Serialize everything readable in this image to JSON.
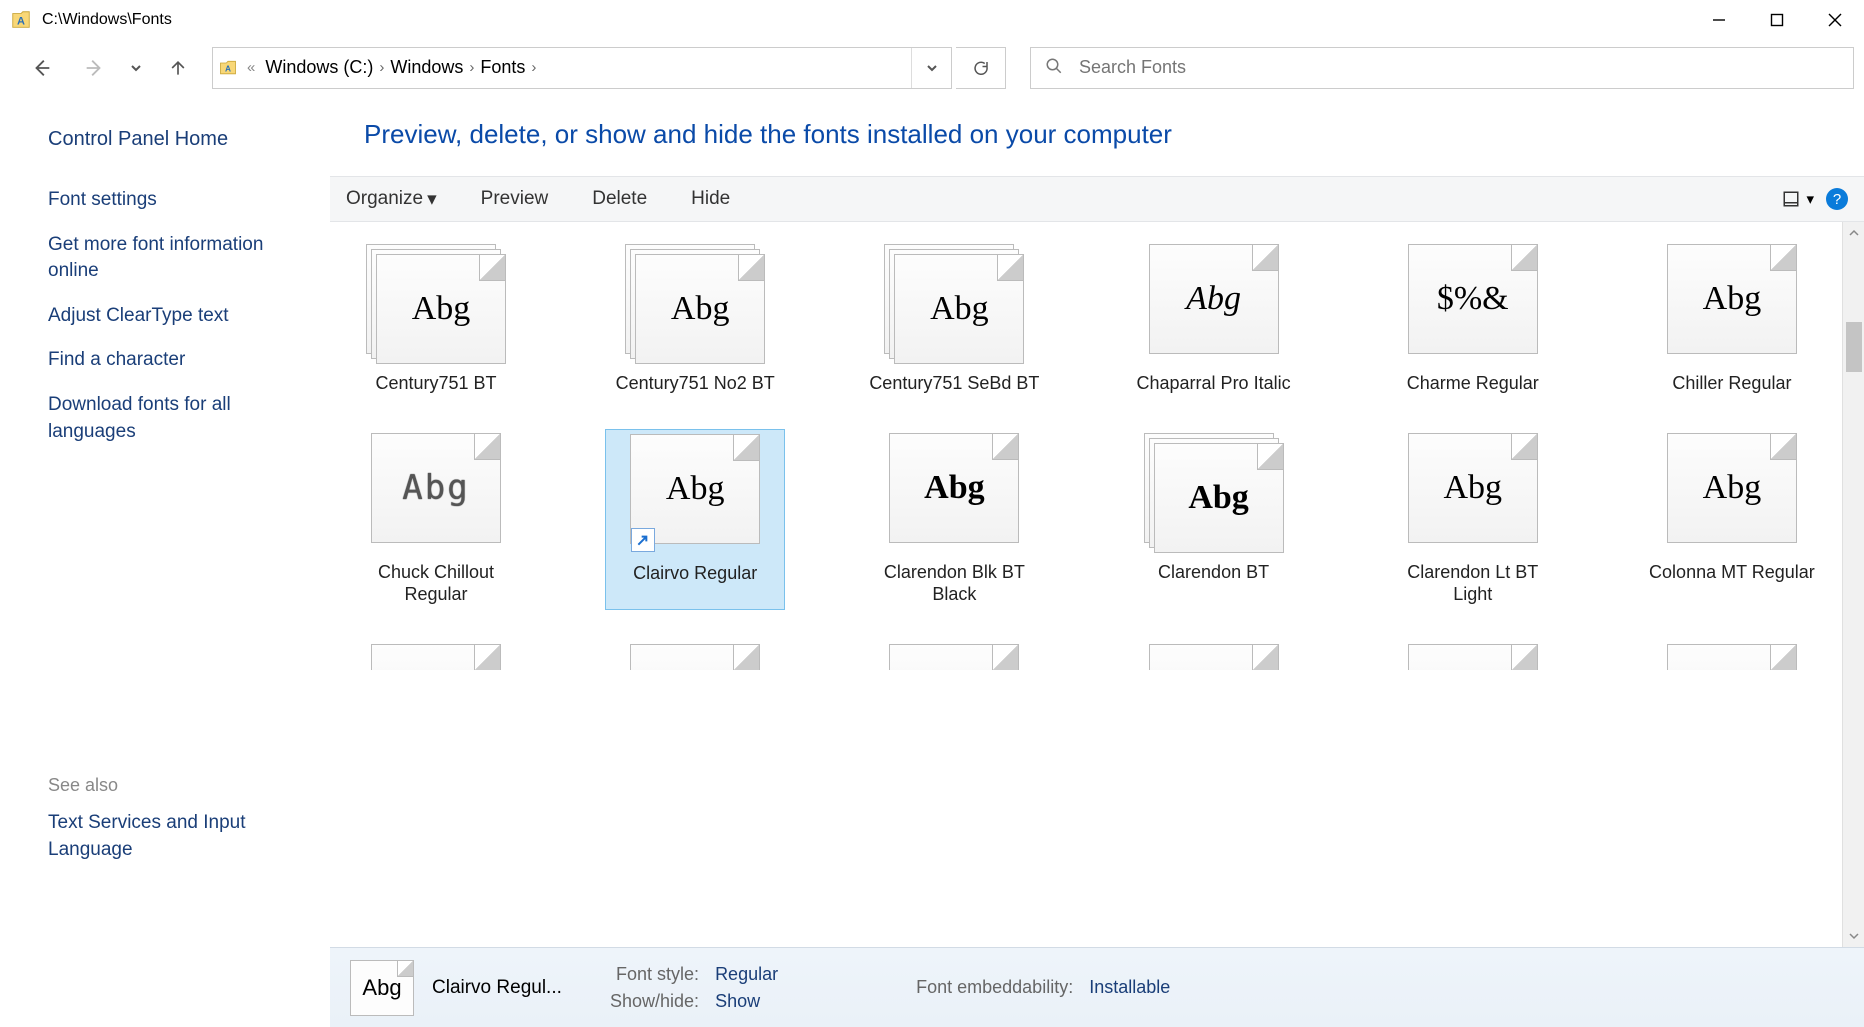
{
  "window": {
    "title": "C:\\Windows\\Fonts"
  },
  "breadcrumbs": {
    "items": [
      {
        "label": "Windows (C:)"
      },
      {
        "label": "Windows"
      },
      {
        "label": "Fonts"
      }
    ]
  },
  "search": {
    "placeholder": "Search Fonts"
  },
  "sidebar": {
    "home": "Control Panel Home",
    "links": [
      "Font settings",
      "Get more font information online",
      "Adjust ClearType text",
      "Find a character",
      "Download fonts for all languages"
    ],
    "see_also_label": "See also",
    "see_also": [
      "Text Services and Input Language"
    ]
  },
  "heading": "Preview, delete, or show and hide the fonts installed on your computer",
  "toolbar": {
    "organize": "Organize",
    "preview": "Preview",
    "delete": "Delete",
    "hide": "Hide",
    "help": "?"
  },
  "fonts": [
    {
      "label": "Century751 BT",
      "sample": "Abg",
      "family": true
    },
    {
      "label": "Century751 No2 BT",
      "sample": "Abg",
      "family": true
    },
    {
      "label": "Century751 SeBd BT",
      "sample": "Abg",
      "family": true
    },
    {
      "label": "Chaparral Pro Italic",
      "sample": "Abg",
      "family": false,
      "italic": true
    },
    {
      "label": "Charme Regular",
      "sample": "$%&",
      "family": false
    },
    {
      "label": "Chiller Regular",
      "sample": "Abg",
      "family": false
    },
    {
      "label": "Chuck Chillout Regular",
      "sample": "Abg",
      "family": false,
      "dotted": true
    },
    {
      "label": "Clairvo Regular",
      "sample": "Abg",
      "family": false,
      "selected": true,
      "shortcut": true
    },
    {
      "label": "Clarendon Blk BT Black",
      "sample": "Abg",
      "family": false,
      "bold": true
    },
    {
      "label": "Clarendon BT",
      "sample": "Abg",
      "family": true,
      "bold": true
    },
    {
      "label": "Clarendon Lt BT Light",
      "sample": "Abg",
      "family": false
    },
    {
      "label": "Colonna MT Regular",
      "sample": "Abg",
      "family": false
    }
  ],
  "details": {
    "name": "Clairvo Regul...",
    "sample": "Abg",
    "style_label": "Font style:",
    "style_value": "Regular",
    "showhide_label": "Show/hide:",
    "showhide_value": "Show",
    "embed_label": "Font embeddability:",
    "embed_value": "Installable"
  }
}
